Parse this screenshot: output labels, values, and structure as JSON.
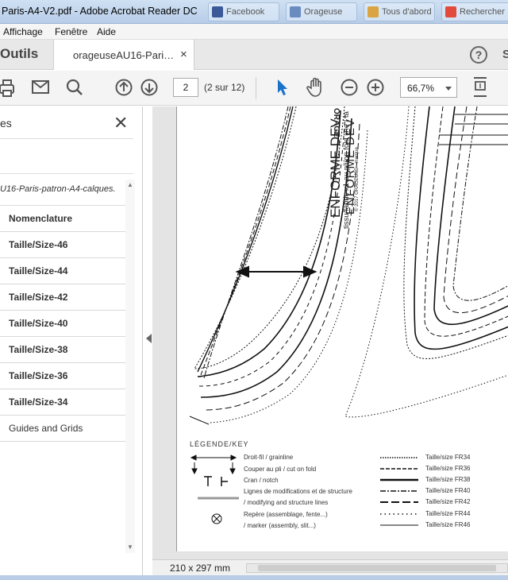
{
  "window": {
    "title": "Paris-A4-V2.pdf - Adobe Acrobat Reader DC",
    "taskbar_items": [
      "Facebook",
      "Orageuse",
      "Tous d'abord",
      "Rechercher"
    ]
  },
  "menu": {
    "items": [
      "Affichage",
      "Fenêtre",
      "Aide"
    ]
  },
  "tabs": {
    "tools_label": "Outils",
    "doc_tab": "orageuseAU16-Pari…",
    "close_glyph": "×",
    "help_glyph": "?",
    "sign_partial": "S"
  },
  "toolbar": {
    "page_value": "2",
    "page_count": "(2 sur 12)",
    "zoom_value": "66,7%"
  },
  "layers_panel": {
    "title": "es",
    "file_name": "U16-Paris-patron-A4-calques.",
    "items": [
      "Nomenclature",
      "Taille/Size-46",
      "Taille/Size-44",
      "Taille/Size-42",
      "Taille/Size-40",
      "Taille/Size-38",
      "Taille/Size-36",
      "Taille/Size-34"
    ],
    "last_item": "Guides and Grids"
  },
  "document": {
    "vertical_text": {
      "brand": "ORAGE",
      "title": "ENFORME DEV",
      "fabric": "tissu/fabric x1 au pli/on fold line / ta",
      "copyright": "© 2017 ORAGEUSE - marque"
    },
    "legend_title": "LÉGENDE/KEY",
    "legend_left": [
      "Droit-fil / grainline",
      "Couper au pli / cut on fold",
      "Cran / notch",
      "Lignes de modifications et de structure",
      "/ modifying and structure lines",
      "Repère (assemblage, fente...)",
      "/ marker (assembly, slit...)"
    ],
    "legend_sizes": [
      "Taille/size FR34",
      "Taille/size FR36",
      "Taille/size FR38",
      "Taille/size FR40",
      "Taille/size FR42",
      "Taille/size FR44",
      "Taille/size FR46"
    ]
  },
  "status": {
    "page_size": "210 x 297 mm"
  }
}
